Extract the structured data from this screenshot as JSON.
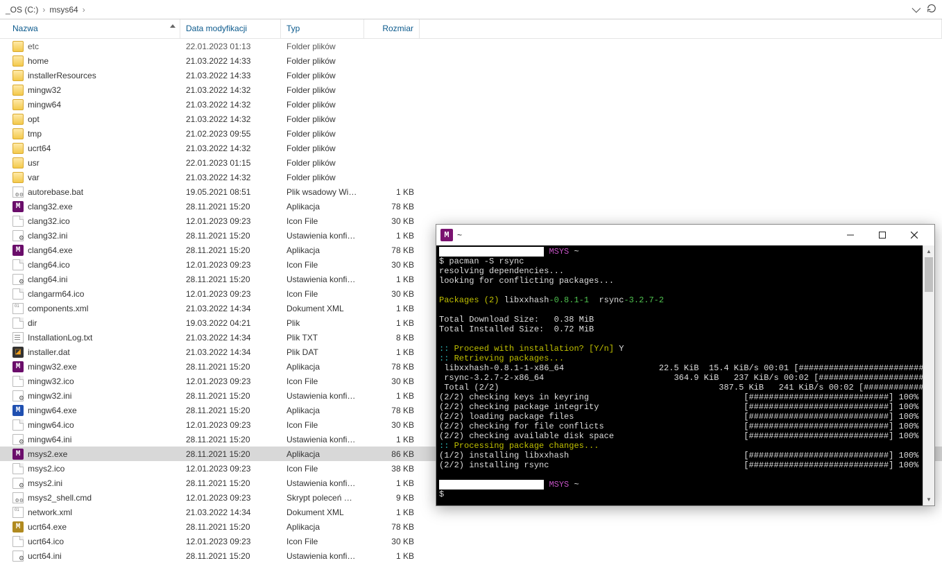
{
  "breadcrumb": {
    "p0": "_OS (C:)",
    "p1": "msys64"
  },
  "columns": {
    "name": "Nazwa",
    "date": "Data modyfikacji",
    "type": "Typ",
    "size": "Rozmiar"
  },
  "files": [
    {
      "ic": "folder",
      "n": "etc",
      "d": "22.01.2023 01:13",
      "t": "Folder plików",
      "s": "",
      "sel": false,
      "faded": true
    },
    {
      "ic": "folder",
      "n": "home",
      "d": "21.03.2022 14:33",
      "t": "Folder plików",
      "s": ""
    },
    {
      "ic": "folder",
      "n": "installerResources",
      "d": "21.03.2022 14:33",
      "t": "Folder plików",
      "s": ""
    },
    {
      "ic": "folder",
      "n": "mingw32",
      "d": "21.03.2022 14:32",
      "t": "Folder plików",
      "s": ""
    },
    {
      "ic": "folder",
      "n": "mingw64",
      "d": "21.03.2022 14:32",
      "t": "Folder plików",
      "s": ""
    },
    {
      "ic": "folder",
      "n": "opt",
      "d": "21.03.2022 14:32",
      "t": "Folder plików",
      "s": ""
    },
    {
      "ic": "folder",
      "n": "tmp",
      "d": "21.02.2023 09:55",
      "t": "Folder plików",
      "s": ""
    },
    {
      "ic": "folder",
      "n": "ucrt64",
      "d": "21.03.2022 14:32",
      "t": "Folder plików",
      "s": ""
    },
    {
      "ic": "folder",
      "n": "usr",
      "d": "22.01.2023 01:15",
      "t": "Folder plików",
      "s": ""
    },
    {
      "ic": "folder",
      "n": "var",
      "d": "21.03.2022 14:32",
      "t": "Folder plików",
      "s": ""
    },
    {
      "ic": "cmd",
      "n": "autorebase.bat",
      "d": "19.05.2021 08:51",
      "t": "Plik wsadowy Win...",
      "s": "1 KB"
    },
    {
      "ic": "mexe",
      "n": "clang32.exe",
      "d": "28.11.2021 15:20",
      "t": "Aplikacja",
      "s": "78 KB"
    },
    {
      "ic": "file",
      "n": "clang32.ico",
      "d": "12.01.2023 09:23",
      "t": "Icon File",
      "s": "30 KB"
    },
    {
      "ic": "ini",
      "n": "clang32.ini",
      "d": "28.11.2021 15:20",
      "t": "Ustawienia konfig...",
      "s": "1 KB"
    },
    {
      "ic": "mexe",
      "n": "clang64.exe",
      "d": "28.11.2021 15:20",
      "t": "Aplikacja",
      "s": "78 KB"
    },
    {
      "ic": "file",
      "n": "clang64.ico",
      "d": "12.01.2023 09:23",
      "t": "Icon File",
      "s": "30 KB"
    },
    {
      "ic": "ini",
      "n": "clang64.ini",
      "d": "28.11.2021 15:20",
      "t": "Ustawienia konfig...",
      "s": "1 KB"
    },
    {
      "ic": "file",
      "n": "clangarm64.ico",
      "d": "12.01.2023 09:23",
      "t": "Icon File",
      "s": "30 KB"
    },
    {
      "ic": "bin",
      "n": "components.xml",
      "d": "21.03.2022 14:34",
      "t": "Dokument XML",
      "s": "1 KB"
    },
    {
      "ic": "file",
      "n": "dir",
      "d": "19.03.2022 04:21",
      "t": "Plik",
      "s": "1 KB"
    },
    {
      "ic": "txt",
      "n": "InstallationLog.txt",
      "d": "21.03.2022 14:34",
      "t": "Plik TXT",
      "s": "8 KB"
    },
    {
      "ic": "dat",
      "n": "installer.dat",
      "d": "21.03.2022 14:34",
      "t": "Plik DAT",
      "s": "1 KB"
    },
    {
      "ic": "mexe",
      "n": "mingw32.exe",
      "d": "28.11.2021 15:20",
      "t": "Aplikacja",
      "s": "78 KB"
    },
    {
      "ic": "file",
      "n": "mingw32.ico",
      "d": "12.01.2023 09:23",
      "t": "Icon File",
      "s": "30 KB"
    },
    {
      "ic": "ini",
      "n": "mingw32.ini",
      "d": "28.11.2021 15:20",
      "t": "Ustawienia konfig...",
      "s": "1 KB"
    },
    {
      "ic": "mexe-blue",
      "n": "mingw64.exe",
      "d": "28.11.2021 15:20",
      "t": "Aplikacja",
      "s": "78 KB"
    },
    {
      "ic": "file",
      "n": "mingw64.ico",
      "d": "12.01.2023 09:23",
      "t": "Icon File",
      "s": "30 KB"
    },
    {
      "ic": "ini",
      "n": "mingw64.ini",
      "d": "28.11.2021 15:20",
      "t": "Ustawienia konfig...",
      "s": "1 KB"
    },
    {
      "ic": "mexe",
      "n": "msys2.exe",
      "d": "28.11.2021 15:20",
      "t": "Aplikacja",
      "s": "86 KB",
      "sel": true
    },
    {
      "ic": "file",
      "n": "msys2.ico",
      "d": "12.01.2023 09:23",
      "t": "Icon File",
      "s": "38 KB"
    },
    {
      "ic": "ini",
      "n": "msys2.ini",
      "d": "28.11.2021 15:20",
      "t": "Ustawienia konfig...",
      "s": "1 KB"
    },
    {
      "ic": "cmd",
      "n": "msys2_shell.cmd",
      "d": "12.01.2023 09:23",
      "t": "Skrypt poleceń Wi...",
      "s": "9 KB"
    },
    {
      "ic": "bin",
      "n": "network.xml",
      "d": "21.03.2022 14:34",
      "t": "Dokument XML",
      "s": "1 KB"
    },
    {
      "ic": "mexe-gold",
      "n": "ucrt64.exe",
      "d": "28.11.2021 15:20",
      "t": "Aplikacja",
      "s": "78 KB"
    },
    {
      "ic": "file",
      "n": "ucrt64.ico",
      "d": "12.01.2023 09:23",
      "t": "Icon File",
      "s": "30 KB"
    },
    {
      "ic": "ini",
      "n": "ucrt64.ini",
      "d": "28.11.2021 15:20",
      "t": "Ustawienia konfig...",
      "s": "1 KB"
    }
  ],
  "terminal": {
    "title_text": "~",
    "prompt_label": "MSYS",
    "prompt_tilde": "~",
    "cmd": "$ pacman -S rsync",
    "l_resolve": "resolving dependencies...",
    "l_conflict": "looking for conflicting packages...",
    "pkg_label": "Packages (2)",
    "pkg1": "libxxhash",
    "pkg1v": "-0.8.1-1",
    "pkg2": "rsync",
    "pkg2v": "-3.2.7-2",
    "tdl": "Total Download Size:   0.38 MiB",
    "tin": "Total Installed Size:  0.72 MiB",
    "proceed": "Proceed with installation? [Y/n]",
    "ans": "Y",
    "retrieve": "Retrieving packages...",
    "r1n": " libxxhash-0.8.1-1-x86_64",
    "r1s": "          22.5 KiB  15.4 KiB/s 00:01 ",
    "r2n": " rsync-3.2.7-2-x86_64",
    "r2s": "             364.9 KiB   237 KiB/s 00:02 ",
    "r3n": " Total (2/2)",
    "r3s": "                      387.5 KiB   241 KiB/s 00:02 ",
    "bar": "[############################] 100%",
    "chk1": "(2/2) checking keys in keyring",
    "chk2": "(2/2) checking package integrity",
    "chk3": "(2/2) loading package files",
    "chk4": "(2/2) checking for file conflicts",
    "chk5": "(2/2) checking available disk space",
    "proc": "Processing package changes...",
    "inst1": "(1/2) installing libxxhash",
    "inst2": "(2/2) installing rsync",
    "dollar": "$"
  }
}
